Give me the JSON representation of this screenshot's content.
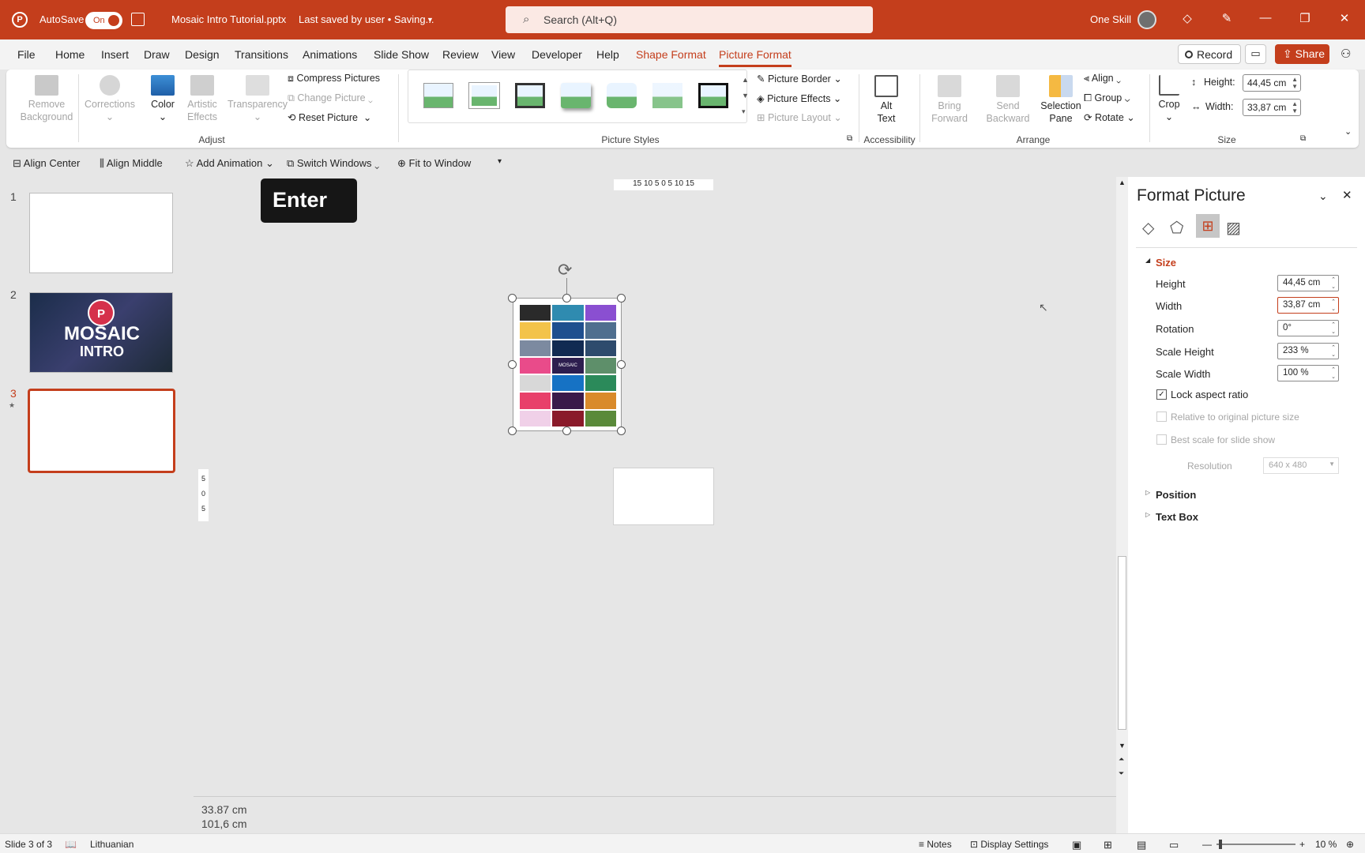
{
  "titlebar": {
    "autosave_label": "AutoSave",
    "autosave_state": "On",
    "doc_title": "Mosaic Intro Tutorial.pptx",
    "save_status": "Last saved by user • Saving...",
    "search_placeholder": "Search (Alt+Q)",
    "user_name": "One Skill"
  },
  "menu": {
    "tabs": [
      "File",
      "Home",
      "Insert",
      "Draw",
      "Design",
      "Transitions",
      "Animations",
      "Slide Show",
      "Review",
      "View",
      "Developer",
      "Help",
      "Shape Format",
      "Picture Format"
    ],
    "active_tab": "Picture Format",
    "record": "Record",
    "share": "Share"
  },
  "ribbon": {
    "adjust": {
      "group": "Adjust",
      "remove_bg": "Remove Background",
      "corrections": "Corrections",
      "color": "Color",
      "artistic": "Artistic Effects",
      "transparency": "Transparency",
      "compress": "Compress Pictures",
      "change": "Change Picture",
      "reset": "Reset Picture"
    },
    "styles": {
      "group": "Picture Styles",
      "border": "Picture Border",
      "effects": "Picture Effects",
      "layout": "Picture Layout"
    },
    "accessibility": {
      "group": "Accessibility",
      "alt_text": "Alt Text"
    },
    "arrange": {
      "group": "Arrange",
      "bring_forward": "Bring Forward",
      "send_backward": "Send Backward",
      "selection_pane": "Selection Pane",
      "align": "Align",
      "group_btn": "Group",
      "rotate": "Rotate"
    },
    "size": {
      "group": "Size",
      "crop": "Crop",
      "height_label": "Height:",
      "height_value": "44,45 cm",
      "width_label": "Width:",
      "width_value": "33,87 cm"
    }
  },
  "qat": {
    "align_center": "Align Center",
    "align_middle": "Align Middle",
    "add_animation": "Add Animation",
    "switch_windows": "Switch Windows",
    "fit_to_window": "Fit to Window"
  },
  "slides": {
    "numbers": [
      "1",
      "2",
      "3"
    ],
    "thumb2_text": [
      "MOSAIC",
      "INTRO"
    ],
    "thumb2_badge": "P"
  },
  "canvas": {
    "key_overlay": "Enter",
    "ruler_top": "15 10 5 0 5 10 15",
    "ruler_left": [
      "5",
      "0",
      "5"
    ],
    "dims_w": "33.87 cm",
    "dims_h": "101,6 cm",
    "mosaic_label": "MOSAIC"
  },
  "format_pane": {
    "title": "Format Picture",
    "section": "Size",
    "height_label": "Height",
    "height_value": "44,45 cm",
    "width_label": "Width",
    "width_value": "33,87 cm",
    "rotation_label": "Rotation",
    "rotation_value": "0°",
    "scale_h_label": "Scale Height",
    "scale_h_value": "233 %",
    "scale_w_label": "Scale Width",
    "scale_w_value": "100 %",
    "lock_aspect": "Lock aspect ratio",
    "relative": "Relative to original picture size",
    "best_scale": "Best scale for slide show",
    "resolution_label": "Resolution",
    "resolution_value": "640 x 480",
    "position": "Position",
    "text_box": "Text Box"
  },
  "status": {
    "slide": "Slide 3 of 3",
    "language": "Lithuanian",
    "notes": "Notes",
    "display": "Display Settings",
    "zoom": "10 %"
  },
  "colors": {
    "accent": "#c43e1c",
    "selected_border": "#c43e1c"
  }
}
